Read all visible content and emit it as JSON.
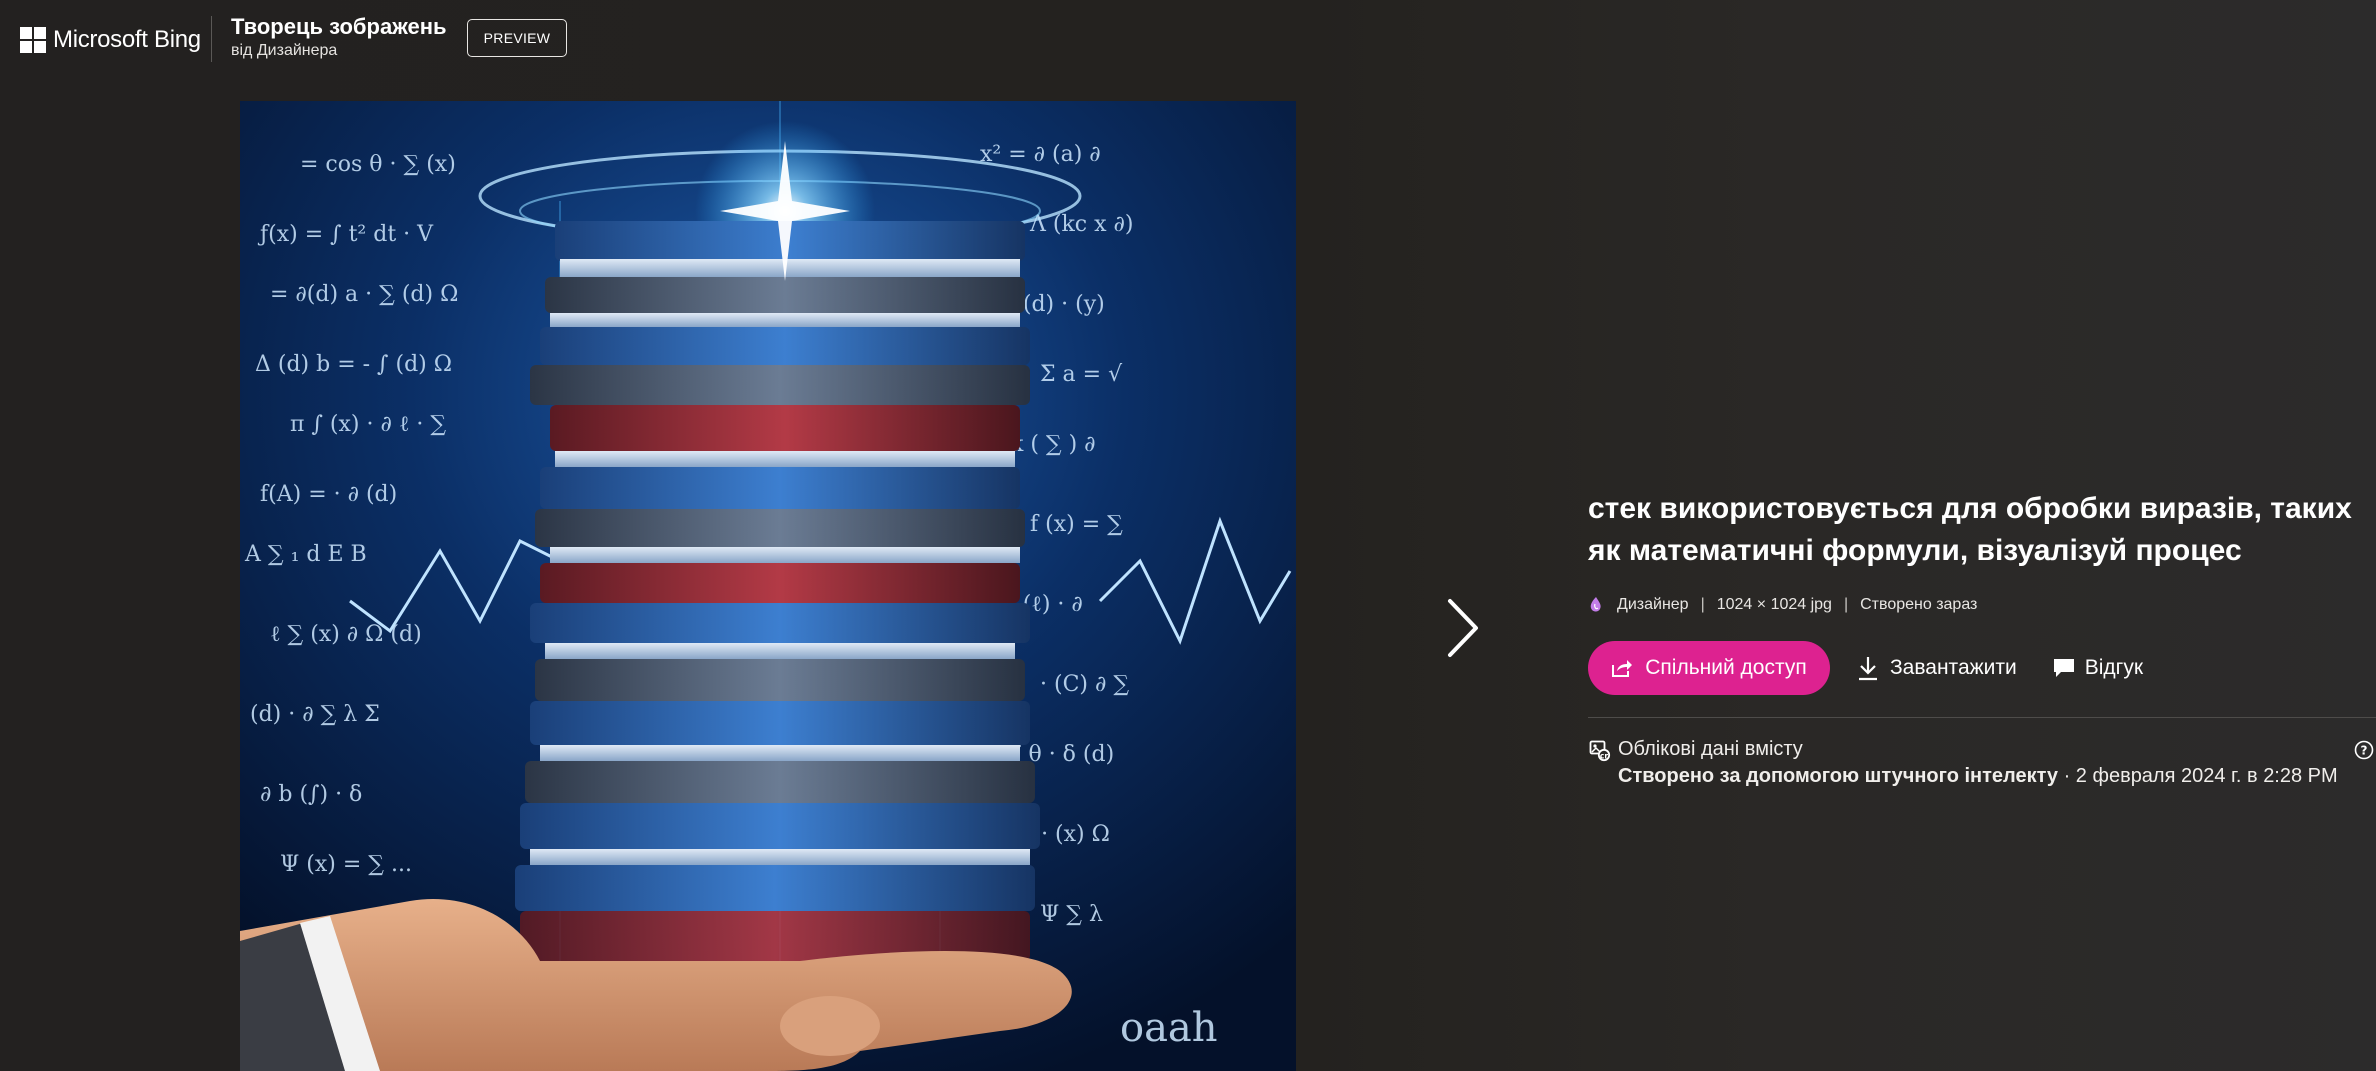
{
  "header": {
    "brand": "Microsoft Bing",
    "product_title": "Творець зображень",
    "product_subtitle": "від Дизайнера",
    "preview_badge": "PREVIEW"
  },
  "image": {
    "description_icon": "generated-image",
    "next_icon": "chevron-right-icon"
  },
  "details": {
    "prompt": "стек використовується для обробки виразів, таких як математичні формули, візуалізуй процес",
    "meta": {
      "source": "Дизайнер",
      "separator": "|",
      "size": "1024 × 1024 jpg",
      "created": "Створено зараз"
    },
    "actions": {
      "share": "Спільний доступ",
      "download": "Завантажити",
      "feedback": "Відгук"
    },
    "credentials": {
      "label": "Облікові дані вмісту",
      "created_by": "Створено за допомогою штучного інтелекту",
      "date": " · 2 февраля 2024 г. в 2:28 PM"
    }
  },
  "colors": {
    "accent": "#dd2290",
    "background": "#232120",
    "image_glow": "#2aa8ff"
  }
}
